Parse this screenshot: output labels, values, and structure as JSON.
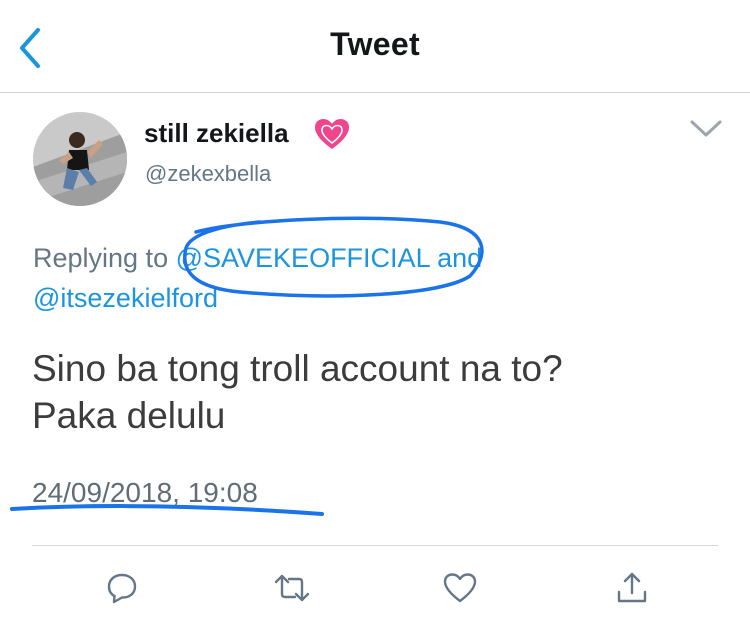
{
  "navbar": {
    "title": "Tweet"
  },
  "tweet": {
    "display_name": "still zekiella",
    "handle": "@zekexbella",
    "reply_prefix": "Replying to",
    "mention_1": "@SAVEKEOFFICIAL",
    "reply_and": "and",
    "mention_2": "@itsezekielford",
    "text_line_1": "Sino ba tong troll account na to?",
    "text_line_2": "Paka delulu",
    "timestamp": "24/09/2018, 19:08"
  },
  "icons": {
    "back": "chevron-left-icon",
    "name_emoji": "heart-emoji-icon",
    "more": "chevron-down-icon",
    "reply": "comment-icon",
    "retweet": "retweet-icon",
    "like": "heart-icon",
    "share": "share-icon"
  },
  "colors": {
    "link_blue": "#1b95e0",
    "annotation_blue": "#1a73e8",
    "secondary_text": "#657786",
    "heart_pink": "#f0448c"
  }
}
